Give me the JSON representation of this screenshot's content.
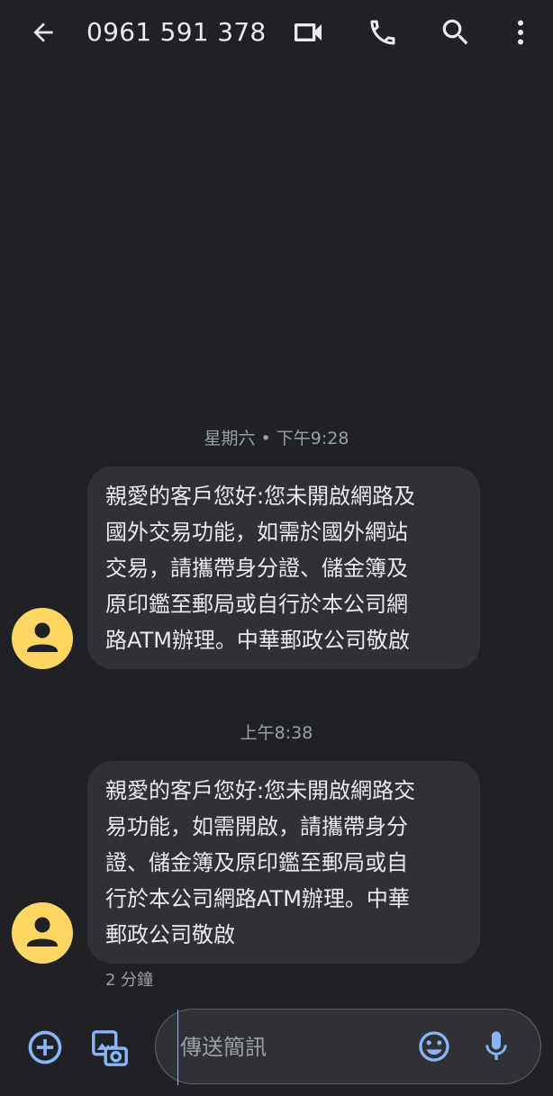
{
  "header": {
    "back_icon": "arrow-left",
    "contact": "0961 591 378",
    "actions": [
      "video-call-icon",
      "phone-icon",
      "search-icon",
      "more-vert-icon"
    ]
  },
  "conversation": {
    "groups": [
      {
        "timestamp": "星期六 • 下午9:28",
        "message": "親愛的客戶您好:您未開啟網路及\n國外交易功能，如需於國外網站\n交易，請攜帶身分證、儲金簿及\n原印鑑至郵局或自行於本公司網\n路ATM辦理。中華郵政公司敬啟"
      },
      {
        "timestamp": "上午8:38",
        "message": "親愛的客戶您好:您未開啟網路交\n易功能，如需開啟，請攜帶身分\n證、儲金簿及原印鑑至郵局或自\n行於本公司網路ATM辦理。中華\n郵政公司敬啟",
        "meta": "2 分鐘"
      }
    ]
  },
  "compose": {
    "placeholder": "傳送簡訊",
    "value": "",
    "icons": [
      "add-circle-icon",
      "gallery-icon",
      "emoji-icon",
      "mic-icon"
    ]
  },
  "colors": {
    "background": "#202124",
    "bubble": "#303134",
    "avatar": "#fdd663",
    "accent": "#8ab4f8",
    "text": "#e8eaed",
    "muted": "#9aa0a6"
  }
}
